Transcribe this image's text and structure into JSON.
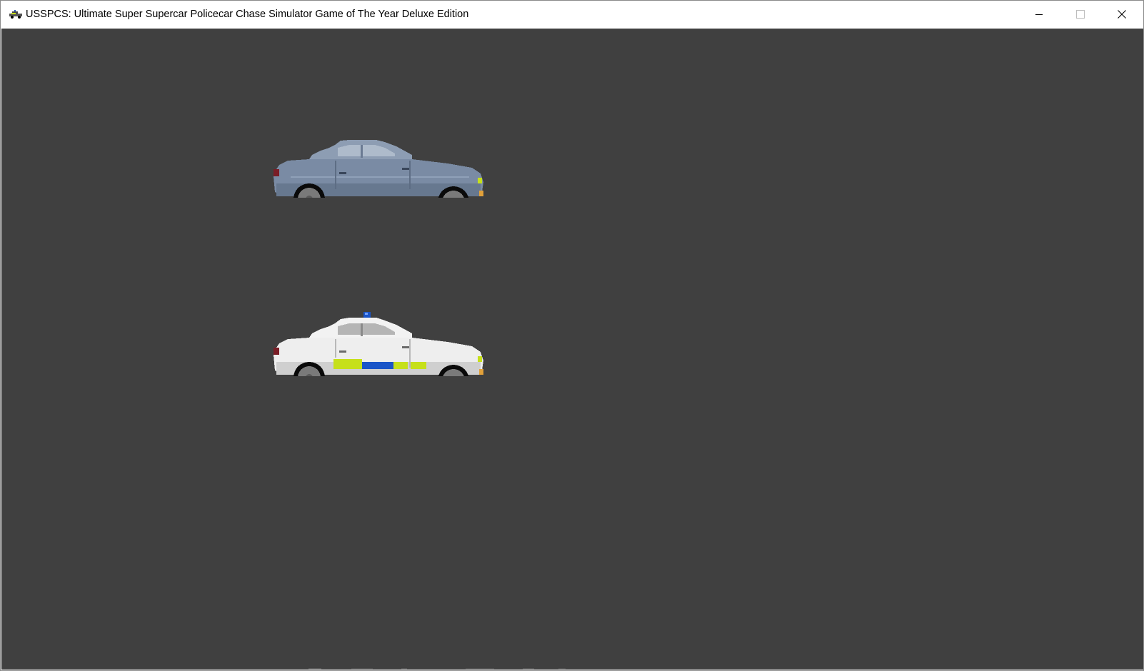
{
  "window": {
    "title": "USSPCS: Ultimate Super Supercar Policecar Chase Simulator Game of The Year Deluxe Edition",
    "icon": "police-car-icon",
    "controls": {
      "minimize_icon": "minimize-icon",
      "maximize_icon": "maximize-icon",
      "close_icon": "close-icon"
    }
  },
  "game": {
    "background_color": "#404040",
    "sprites": [
      {
        "name": "civilian-car",
        "body_color": "#7a8ba4"
      },
      {
        "name": "police-car",
        "body_color": "#eeeeee",
        "stripe_colors": [
          "#c6e01a",
          "#1a55c8"
        ]
      }
    ]
  }
}
